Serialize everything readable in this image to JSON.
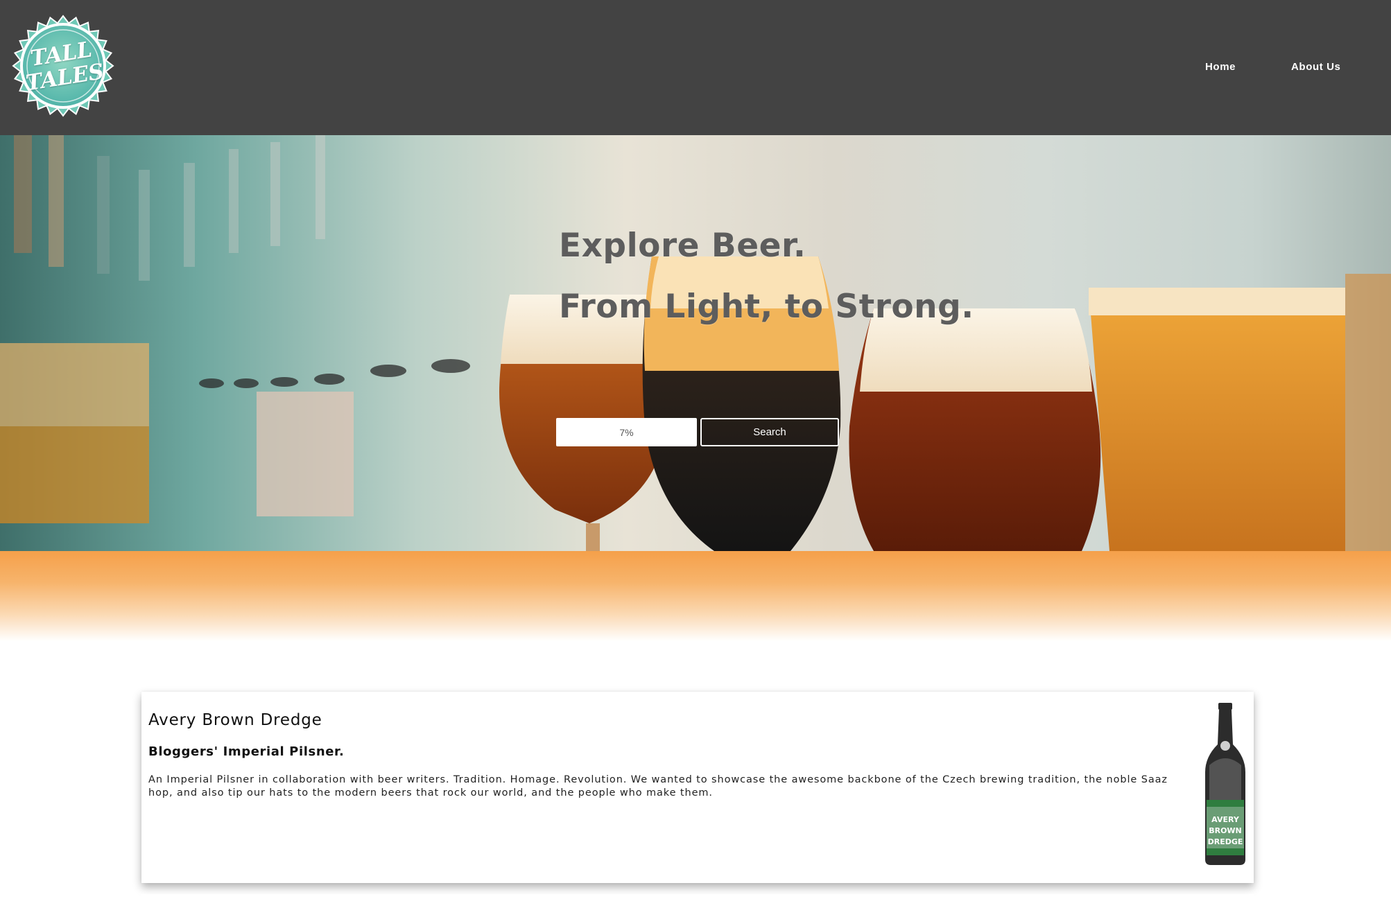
{
  "logo": {
    "line1": "TALL",
    "line2": "TALES",
    "icon": "bottle-cap-logo-icon"
  },
  "nav": {
    "items": [
      {
        "label": "Home"
      },
      {
        "label": "About Us"
      }
    ]
  },
  "hero": {
    "title_line1": "Explore Beer.",
    "title_line2": "From Light, to Strong.",
    "search": {
      "value": "7%",
      "button_label": "Search"
    }
  },
  "beer_card": {
    "brewer": "Avery Brown Dredge",
    "name": "Bloggers' Imperial Pilsner.",
    "description": "An Imperial Pilsner in collaboration with beer writers. Tradition. Homage. Revolution. We wanted to showcase the awesome backbone of the Czech brewing tradition, the noble Saaz hop, and also tip our hats to the modern beers that rock our world, and the people who make them.",
    "image_icon": "beer-bottle-icon"
  },
  "colors": {
    "header_bg": "#434343",
    "accent_orange": "#f5a04a",
    "logo_teal": "#6fc8b6",
    "hero_text": "#5d5d5d"
  }
}
